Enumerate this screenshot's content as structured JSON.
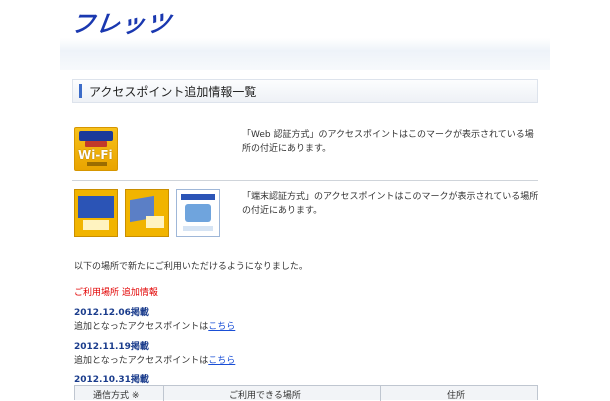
{
  "header": {
    "logo": "フレッツ"
  },
  "section": {
    "title": "アクセスポイント追加情報一覧"
  },
  "rows": [
    {
      "badge_label": "Wi-Fi",
      "text": "「Web 認証方式」のアクセスポイントはこのマークが表示されている場所の付近にあります。"
    },
    {
      "text": "「端末認証方式」のアクセスポイントはこのマークが表示されている場所の付近にあります。"
    }
  ],
  "intro": "以下の場所で新たにご利用いただけるようになりました。",
  "updates_title": "ご利用場所 追加情報",
  "updates": [
    {
      "date": "2012.12.06掲載",
      "text": "追加となったアクセスポイントは",
      "link": "こちら"
    },
    {
      "date": "2012.11.19掲載",
      "text": "追加となったアクセスポイントは",
      "link": "こちら"
    },
    {
      "date": "2012.10.31掲載"
    }
  ],
  "table": {
    "headers": [
      "通信方式 ※",
      "ご利用できる場所",
      "住所"
    ]
  }
}
